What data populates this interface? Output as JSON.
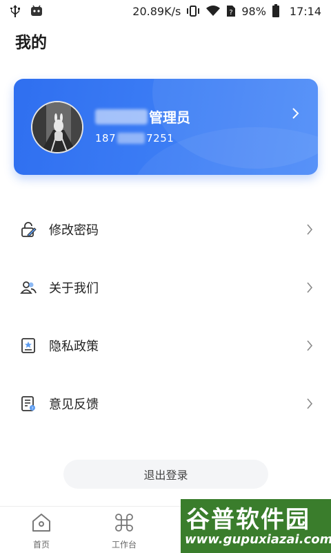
{
  "status_bar": {
    "net_speed": "20.89K/s",
    "battery": "98%",
    "time": "17:14",
    "icons": [
      "usb-icon",
      "android-bot-icon",
      "vibrate-icon",
      "wifi-icon",
      "sim-unknown-icon",
      "battery-icon"
    ]
  },
  "page": {
    "title": "我的"
  },
  "profile": {
    "role": "管理员",
    "phone_prefix": "187",
    "phone_suffix": "7251"
  },
  "menu": {
    "items": [
      {
        "label": "修改密码",
        "icon": "edit-lock-icon"
      },
      {
        "label": "关于我们",
        "icon": "users-icon"
      },
      {
        "label": "隐私政策",
        "icon": "privacy-doc-icon"
      },
      {
        "label": "意见反馈",
        "icon": "feedback-doc-icon"
      }
    ]
  },
  "logout": {
    "label": "退出登录"
  },
  "tabs": [
    {
      "label": "首页",
      "icon": "home-icon"
    },
    {
      "label": "工作台",
      "icon": "command-icon"
    }
  ],
  "watermark": {
    "title": "谷普软件园",
    "url": "www.gupuxiazai.com"
  },
  "colors": {
    "card_blue": "#3a78f2",
    "accent": "#2f6ff0",
    "text": "#222222"
  }
}
